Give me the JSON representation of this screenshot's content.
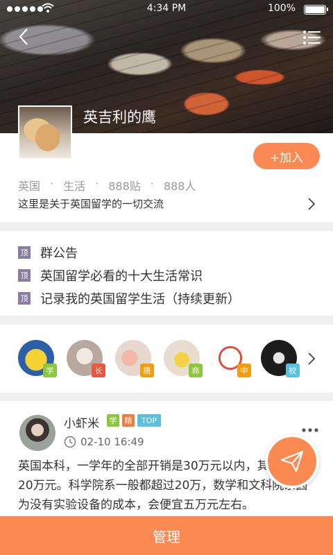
{
  "status_bar": {
    "time": "4:34 PM",
    "battery": "100%"
  },
  "group": {
    "name": "英吉利的鹰",
    "join_label": "+加入",
    "country": "英国",
    "category": "生活",
    "posts": "888贴",
    "people": "888人",
    "separator": "·",
    "description": "这里是关于英国留学的一切交流"
  },
  "notices": {
    "tag": "顶",
    "items": [
      "群公告",
      "英国留学必看的十大生活常识",
      "记录我的英国留学生活（持续更新）"
    ]
  },
  "members": [
    {
      "badge": "学",
      "badge_color": "#8dc63f"
    },
    {
      "badge": "长",
      "badge_color": "#e9573f"
    },
    {
      "badge": "唐",
      "badge_color": "#f39c12"
    },
    {
      "badge": "商",
      "badge_color": "#8dc63f"
    },
    {
      "badge": "中",
      "badge_color": "#f39c12"
    },
    {
      "badge": "校",
      "badge_color": "#5bc0de"
    }
  ],
  "post": {
    "author": "小虾米",
    "tags": [
      {
        "label": "学",
        "color": "#8dc63f"
      },
      {
        "label": "精",
        "color": "#f07c3c"
      },
      {
        "label": "TOP",
        "color": "#5bc0de"
      }
    ],
    "time": "02-10 16:49",
    "body": "英国本科，一学年的全部开销是30万元以内，其中学费20万元。科学院系一般都超过20万，数学和文科院系因为没有实验设备的成本，会便宜五万元左右。"
  },
  "bottom_bar": {
    "manage_label": "管理"
  },
  "colors": {
    "accent": "#fb8a52",
    "notice_tag": "#8a7ba0"
  }
}
